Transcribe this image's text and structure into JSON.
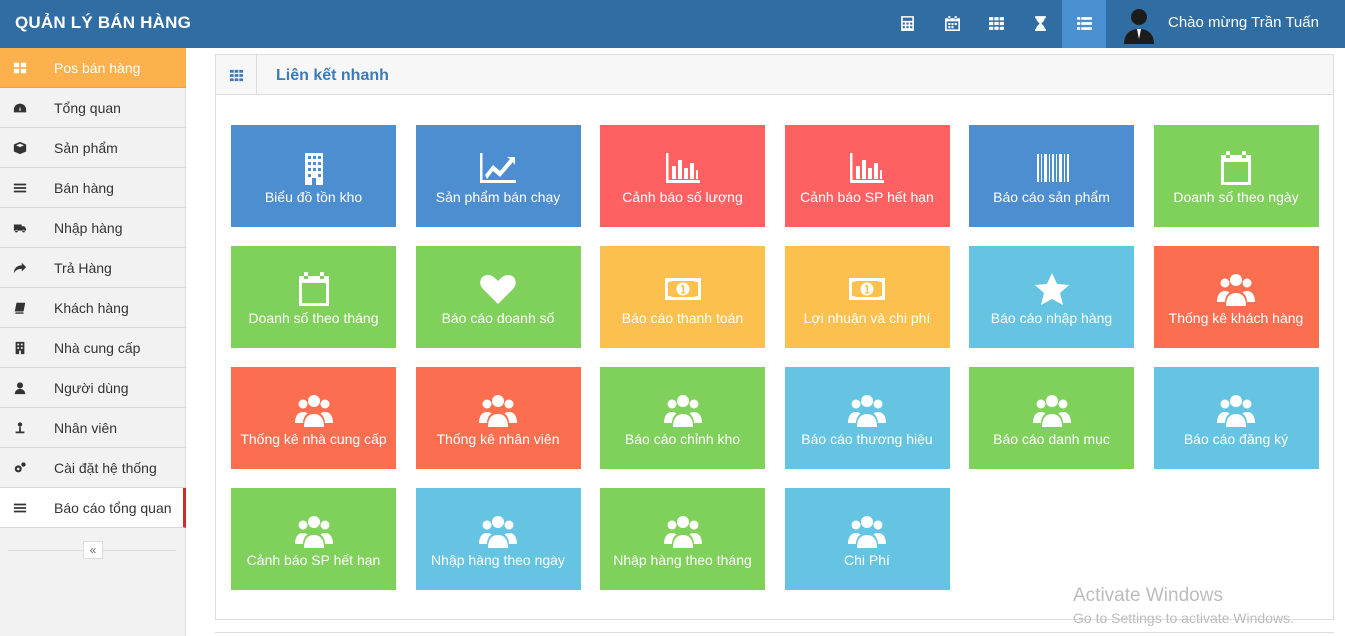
{
  "app": {
    "title": "QUẢN LÝ BÁN HÀNG"
  },
  "navbar": {
    "icons": [
      "calculator-icon",
      "calendar-icon",
      "grid-icon",
      "hourglass-icon",
      "list-icon"
    ],
    "user": {
      "greeting": "Chào mừng Trần Tuấn"
    }
  },
  "sidebar": {
    "items": [
      {
        "label": "Pos bán hàng",
        "icon": "grid-icon"
      },
      {
        "label": "Tổng quan",
        "icon": "dashboard-icon"
      },
      {
        "label": "Sản phẩm",
        "icon": "box-icon"
      },
      {
        "label": "Bán hàng",
        "icon": "menu-icon"
      },
      {
        "label": "Nhập hàng",
        "icon": "truck-icon"
      },
      {
        "label": "Trả Hàng",
        "icon": "share-icon"
      },
      {
        "label": "Khách hàng",
        "icon": "book-icon"
      },
      {
        "label": "Nhà cung cấp",
        "icon": "building-icon"
      },
      {
        "label": "Người dùng",
        "icon": "user-icon"
      },
      {
        "label": "Nhân viên",
        "icon": "worker-icon"
      },
      {
        "label": "Cài đặt hệ thống",
        "icon": "cogs-icon"
      },
      {
        "label": "Báo cáo tổng quan",
        "icon": "menu-icon"
      }
    ],
    "collapse_label": "«"
  },
  "panel": {
    "title": "Liên kết nhanh",
    "tiles": [
      {
        "label": "Biểu đồ tồn kho",
        "icon": "building-icon",
        "color": "#4d8ed0"
      },
      {
        "label": "Sản phẩm bán chạy",
        "icon": "line-chart-icon",
        "color": "#4d8ed0"
      },
      {
        "label": "Cảnh báo số lượng",
        "icon": "bar-chart-icon",
        "color": "#ff6163"
      },
      {
        "label": "Cảnh báo SP hết hạn",
        "icon": "bar-chart-icon",
        "color": "#ff6163"
      },
      {
        "label": "Báo cáo sản phẩm",
        "icon": "barcode-icon",
        "color": "#4d8ed0"
      },
      {
        "label": "Doanh số theo ngày",
        "icon": "calendar-icon",
        "color": "#80d05c"
      },
      {
        "label": "Doanh số theo tháng",
        "icon": "calendar-icon",
        "color": "#80d05c"
      },
      {
        "label": "Báo cáo doanh số",
        "icon": "heart-icon",
        "color": "#80d05c"
      },
      {
        "label": "Báo cáo thanh toán",
        "icon": "money-icon",
        "color": "#fbc04d"
      },
      {
        "label": "Lợi nhuận và chi phí",
        "icon": "money-icon",
        "color": "#fbc04d"
      },
      {
        "label": "Báo cáo nhập hàng",
        "icon": "star-icon",
        "color": "#66c4e3"
      },
      {
        "label": "Thống kê khách hàng",
        "icon": "users-icon",
        "color": "#fc6e50"
      },
      {
        "label": "Thống kê nhà cung cấp",
        "icon": "users-icon",
        "color": "#fc6e50"
      },
      {
        "label": "Thống kê nhân viên",
        "icon": "users-icon",
        "color": "#fc6e50"
      },
      {
        "label": "Báo cáo chỉnh kho",
        "icon": "users-icon",
        "color": "#80d05c"
      },
      {
        "label": "Báo cáo thương hiệu",
        "icon": "users-icon",
        "color": "#66c4e3"
      },
      {
        "label": "Báo cáo danh mục",
        "icon": "users-icon",
        "color": "#80d05c"
      },
      {
        "label": "Báo cáo đăng ký",
        "icon": "users-icon",
        "color": "#66c4e3"
      },
      {
        "label": "Cảnh báo SP hết hạn",
        "icon": "users-icon",
        "color": "#80d05c"
      },
      {
        "label": "Nhập hàng theo ngày",
        "icon": "users-icon",
        "color": "#66c4e3"
      },
      {
        "label": "Nhập hàng theo tháng",
        "icon": "users-icon",
        "color": "#80d05c"
      },
      {
        "label": "Chi Phí",
        "icon": "users-icon",
        "color": "#66c4e3"
      }
    ]
  },
  "watermark": {
    "title": "Activate Windows",
    "subtitle": "Go to Settings to activate Windows."
  }
}
